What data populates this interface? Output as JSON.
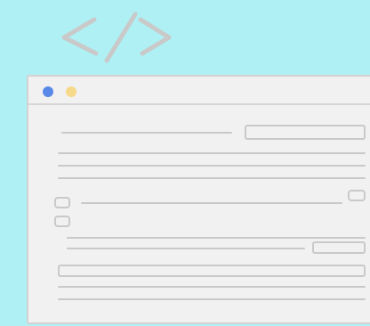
{
  "colors": {
    "background": "#aff0f4",
    "window": "#f1f1f1",
    "sketch_line": "#c9c9c9",
    "dot_blue": "#5a88e8",
    "dot_yellow": "#f6d98a"
  },
  "icons": {
    "top": "code-brackets-icon",
    "window_controls": [
      "blue-dot-icon",
      "yellow-dot-icon"
    ]
  }
}
